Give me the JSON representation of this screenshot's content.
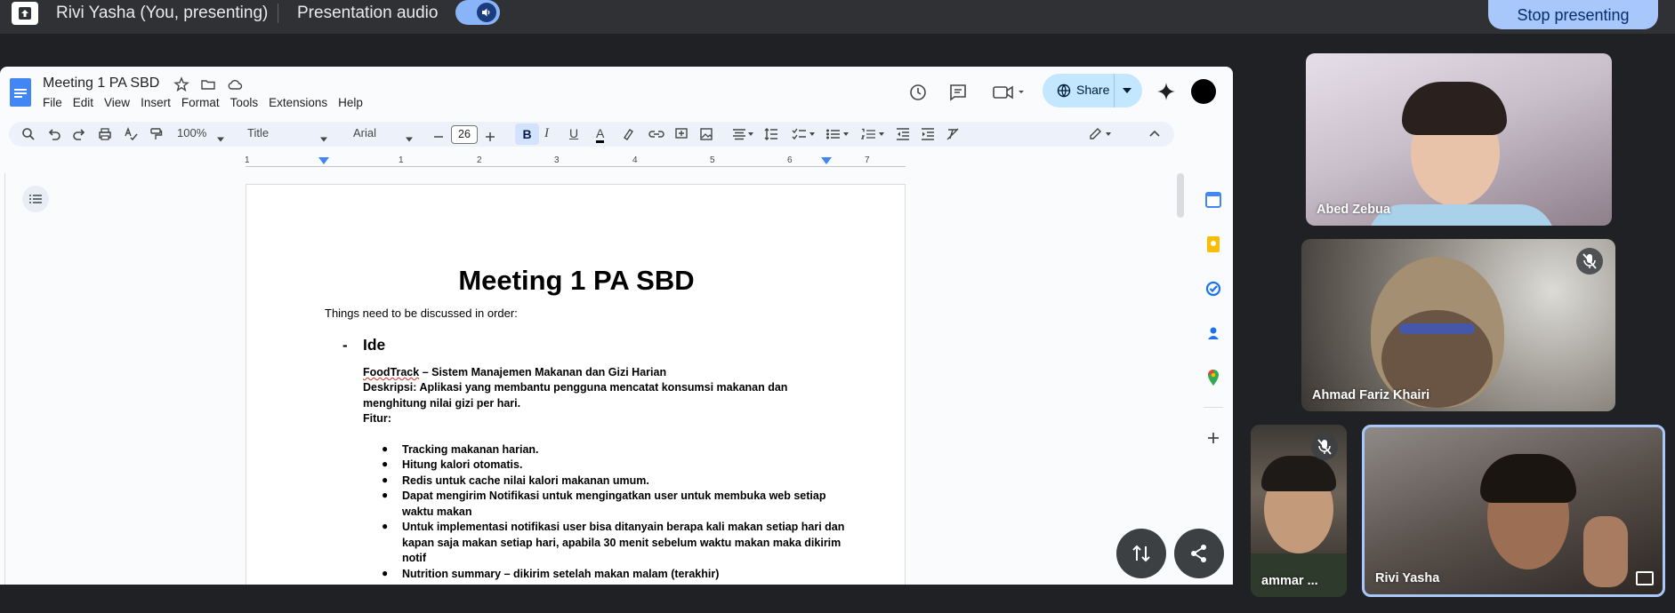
{
  "presenting_bar": {
    "presenter_label": "Rivi Yasha (You, presenting)",
    "audio_label": "Presentation audio",
    "stop_label": "Stop presenting",
    "accent": "#a8c7fa"
  },
  "docs": {
    "title": "Meeting 1 PA SBD",
    "menu": [
      "File",
      "Edit",
      "View",
      "Insert",
      "Format",
      "Tools",
      "Extensions",
      "Help"
    ],
    "share_label": "Share",
    "toolbar": {
      "zoom": "100%",
      "style": "Title",
      "font": "Arial",
      "font_size": "26",
      "bold": "B",
      "italic": "I",
      "underline": "U",
      "text_color": "A"
    },
    "ruler_numbers": [
      "1",
      "1",
      "2",
      "3",
      "4",
      "5",
      "6",
      "7"
    ],
    "content": {
      "heading": "Meeting 1 PA SBD",
      "intro": "Things need to be discussed in order:",
      "dash": "-",
      "section": "Ide",
      "app_name": "FoodTrack",
      "app_tagline": " – Sistem Manajemen Makanan dan Gizi Harian",
      "desc_line1": "Deskripsi: Aplikasi yang membantu pengguna mencatat konsumsi makanan dan",
      "desc_line2": "menghitung nilai gizi per hari.",
      "fitur": "Fitur:",
      "bullet": "●",
      "features": [
        "Tracking makanan harian.",
        "Hitung kalori otomatis.",
        "Redis untuk cache nilai kalori makanan umum.",
        "Dapat mengirim Notifikasi untuk mengingatkan user untuk membuka web setiap waktu makan",
        "Untuk implementasi notifikasi user bisa ditanyain berapa kali makan setiap hari dan kapan saja makan setiap hari, apabila 30 menit sebelum waktu makan maka dikirim notif",
        "Nutrition summary – dikirim setelah makan malam (terakhir)"
      ]
    }
  },
  "participants": [
    {
      "name": "Abed Zebua"
    },
    {
      "name": "Ahmad Fariz Khairi"
    },
    {
      "name": "ammar ..."
    },
    {
      "name": "Rivi Yasha"
    }
  ]
}
